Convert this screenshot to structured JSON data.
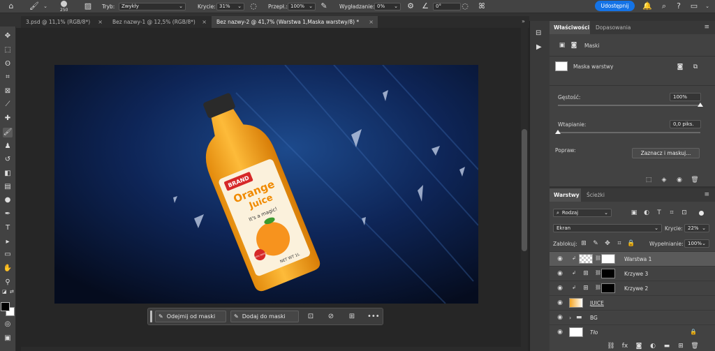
{
  "options_bar": {
    "brush_size": "250",
    "mode_label": "Tryb:",
    "mode_value": "Zwykły",
    "opacity_label": "Krycie:",
    "opacity_value": "31%",
    "flow_label": "Przepł.:",
    "flow_value": "100%",
    "smoothing_label": "Wygładzanie:",
    "smoothing_value": "0%",
    "angle_value": "0°",
    "share_label": "Udostępnij"
  },
  "tabs": [
    {
      "label": "3.psd @ 11,1% (RGB/8*)"
    },
    {
      "label": "Bez nazwy-1 @ 12,5% (RGB/8*)"
    },
    {
      "label": "Bez nazwy-2 @ 41,7% (Warstwa 1,Maska warstwy/8) *"
    }
  ],
  "canvas": {
    "brand_label": "BRAND",
    "product_line1": "Orange",
    "product_line2": "Juice",
    "tagline": "It's a magic!",
    "net_wt": "NET WT 1L",
    "sticker": "100% FRESH"
  },
  "context_bar": {
    "subtract_label": "Odejmij od maski",
    "add_label": "Dodaj do maski",
    "more": "•••"
  },
  "properties": {
    "tab_properties": "Właściwości",
    "tab_adjustments": "Dopasowania",
    "masks_label": "Maski",
    "layer_mask_label": "Maska warstwy",
    "density_label": "Gęstość:",
    "density_value": "100%",
    "density_level": 1.0,
    "feather_label": "Wtapianie:",
    "feather_value": "0,0 piks.",
    "feather_level": 0.0,
    "refine_label": "Popraw:",
    "select_mask_button": "Zaznacz i maskuj..."
  },
  "layers_panel": {
    "tab_layers": "Warstwy",
    "tab_paths": "Ścieżki",
    "filter_value": "Rodzaj",
    "blend_mode": "Ekran",
    "opacity_label": "Krycie:",
    "opacity_value": "22%",
    "lock_label": "Zablokuj:",
    "fill_label": "Wypełnianie:",
    "fill_value": "100%",
    "layers": [
      {
        "name": "Warstwa 1",
        "selected": true
      },
      {
        "name": "Krzywe 3",
        "selected": false
      },
      {
        "name": "Krzywe 2",
        "selected": false
      },
      {
        "name": "JUICE",
        "selected": false
      },
      {
        "name": "BG",
        "selected": false
      },
      {
        "name": "Tło",
        "selected": false
      }
    ]
  },
  "colors": {
    "accent": "#1473e6",
    "panel": "#424242",
    "canvas_bg": "#08142e",
    "juice": "#f5a623"
  }
}
